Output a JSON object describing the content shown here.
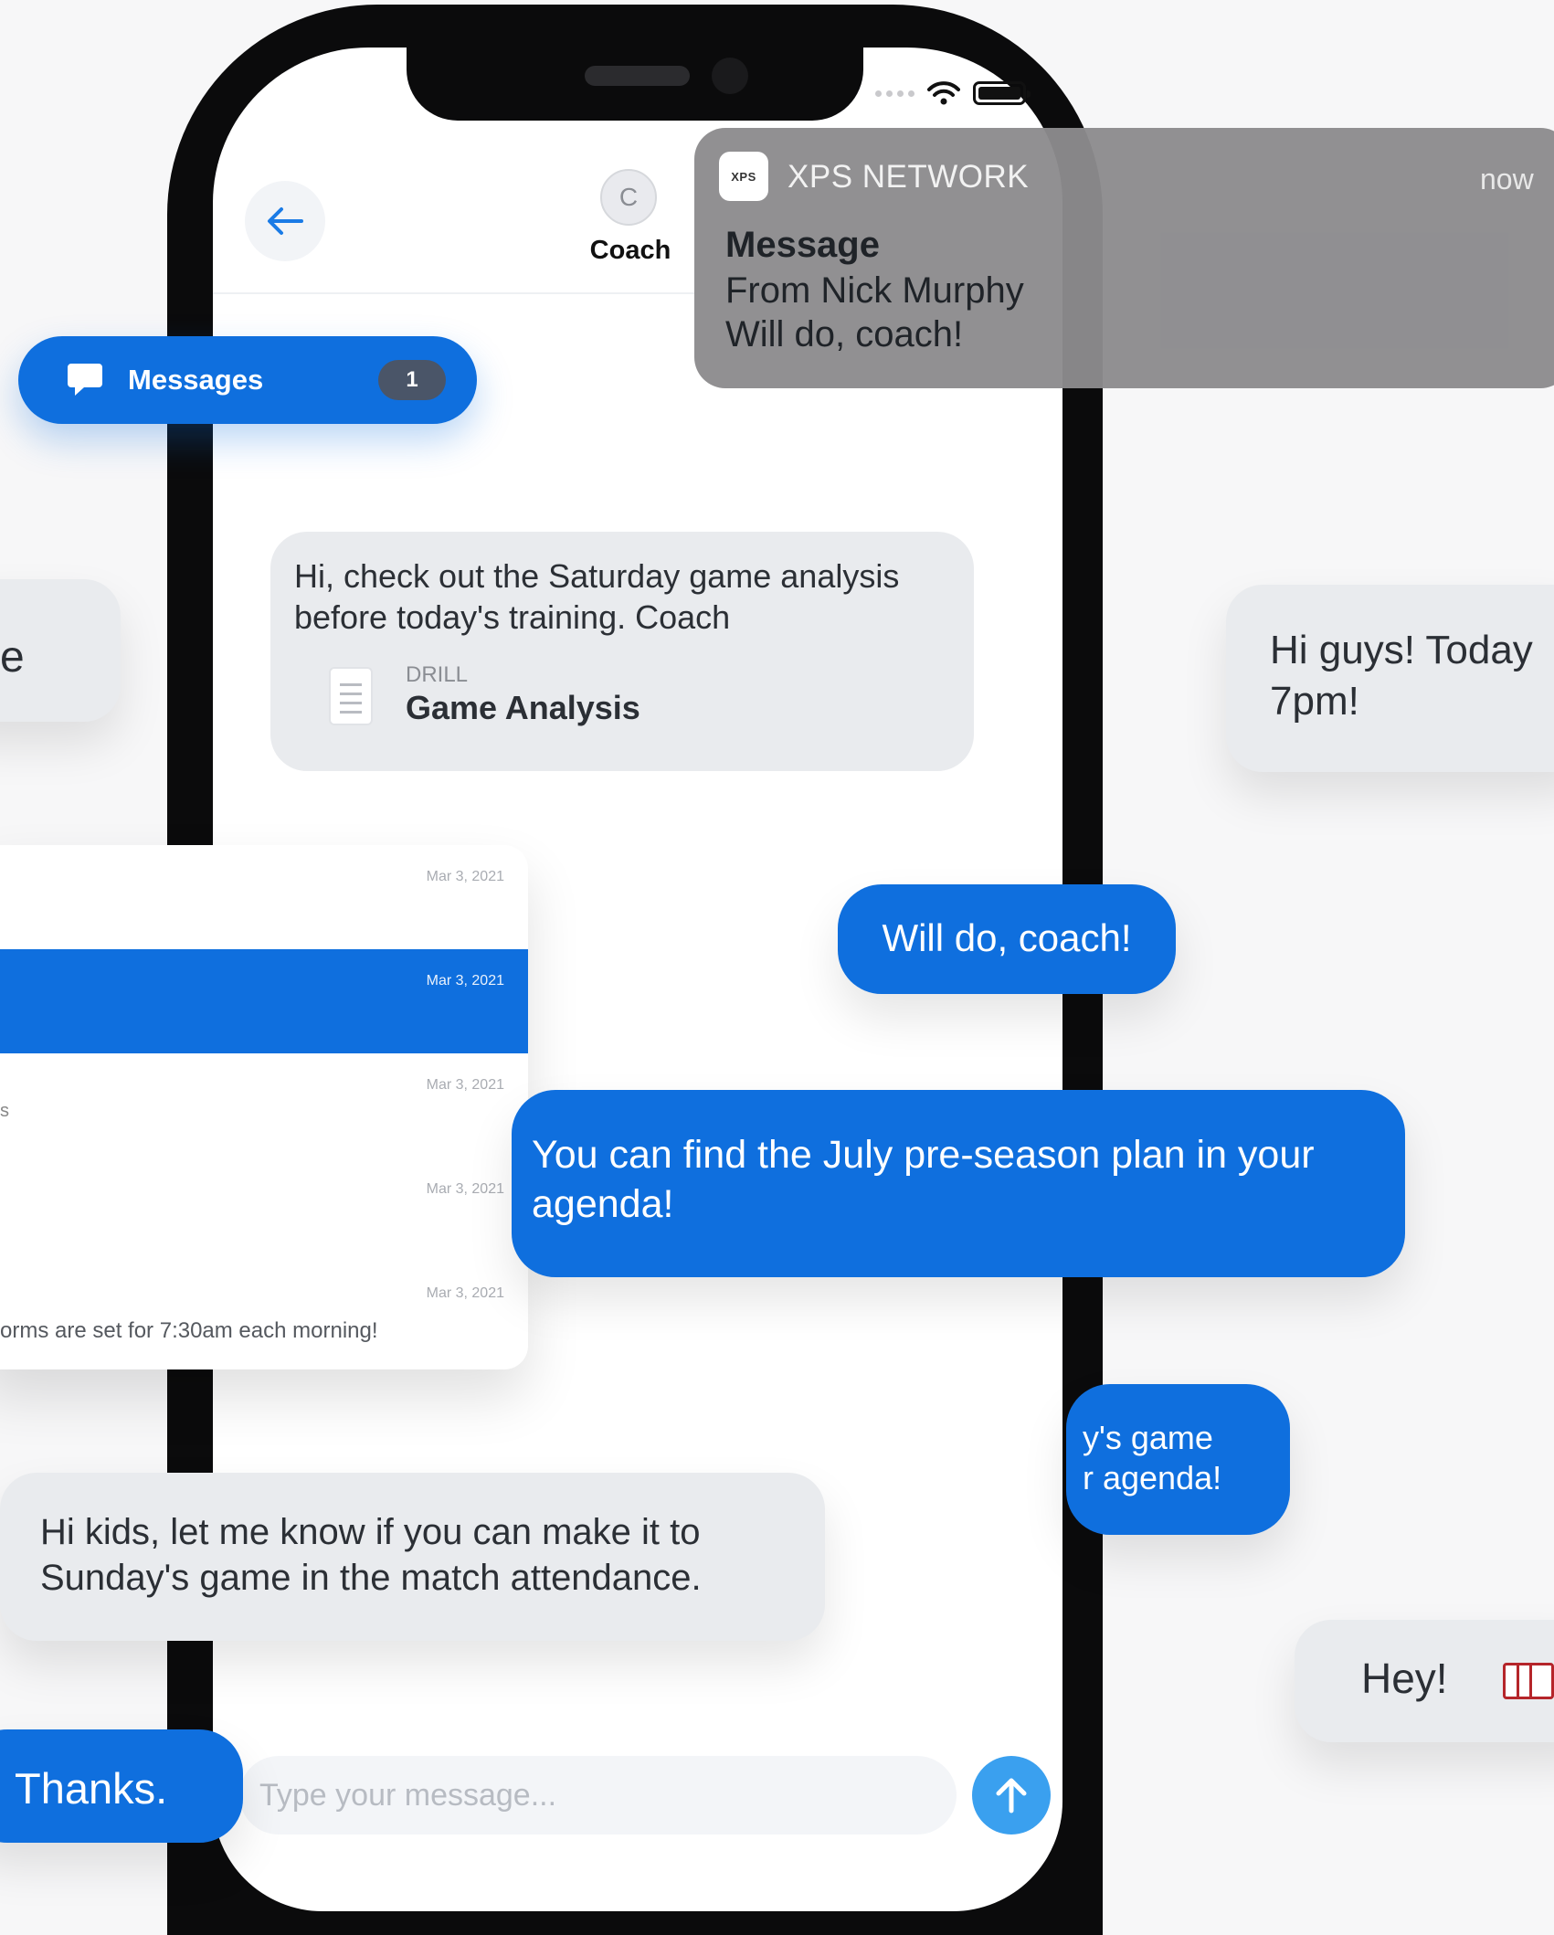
{
  "status_bar": {
    "icons": [
      "signal-dots-icon",
      "wifi-icon",
      "battery-icon"
    ]
  },
  "header": {
    "back_icon": "arrow-left-icon",
    "avatar_initial": "C",
    "title": "Coach"
  },
  "notification": {
    "app_name": "XPS NETWORK",
    "app_icon_text": "XPS",
    "time": "now",
    "title": "Message",
    "line1": "From Nick Murphy",
    "line2": "Will do, coach!"
  },
  "messages_pill": {
    "label": "Messages",
    "badge": "1",
    "icon": "chat-bubble-icon"
  },
  "coach_message": {
    "text": "Hi, check out the Saturday game analysis before today's training. Coach",
    "attachment_type": "DRILL",
    "attachment_title": "Game Analysis"
  },
  "right_greeting": {
    "line1": "Hi guys! Today",
    "line2": "7pm!"
  },
  "left_partial": {
    "text": "e"
  },
  "will_do": {
    "text": "Will do, coach!"
  },
  "july_message": {
    "text": "You can find the July pre-season plan in your agenda!"
  },
  "agenda_partial": {
    "line1": "y's game",
    "line2": "r agenda!"
  },
  "kids_message": {
    "text": "Hi kids, let me know if you can make it to Sunday's game in the match attendance."
  },
  "hey_message": {
    "text": "Hey!",
    "emoji": "goal-net-icon"
  },
  "thanks_message": {
    "text": "Thanks."
  },
  "composer": {
    "placeholder": "Type your message...",
    "send_icon": "arrow-up-icon"
  },
  "conversation_list": {
    "rows": [
      {
        "date": "Mar 3, 2021",
        "preview": "",
        "mark": ""
      },
      {
        "date": "Mar 3, 2021",
        "preview": "",
        "mark": "",
        "selected": true
      },
      {
        "date": "Mar 3, 2021",
        "preview": "",
        "mark": "s"
      },
      {
        "date": "Mar 3, 2021",
        "preview": "",
        "mark": ""
      },
      {
        "date": "Mar 3, 2021",
        "preview": "orms are set for 7:30am each morning!",
        "mark": ""
      }
    ]
  },
  "colors": {
    "accent": "#0f6fde",
    "bubble_gray": "#e9ebee",
    "notification_bg": "#8c8b8e",
    "send": "#3aa0ef"
  }
}
